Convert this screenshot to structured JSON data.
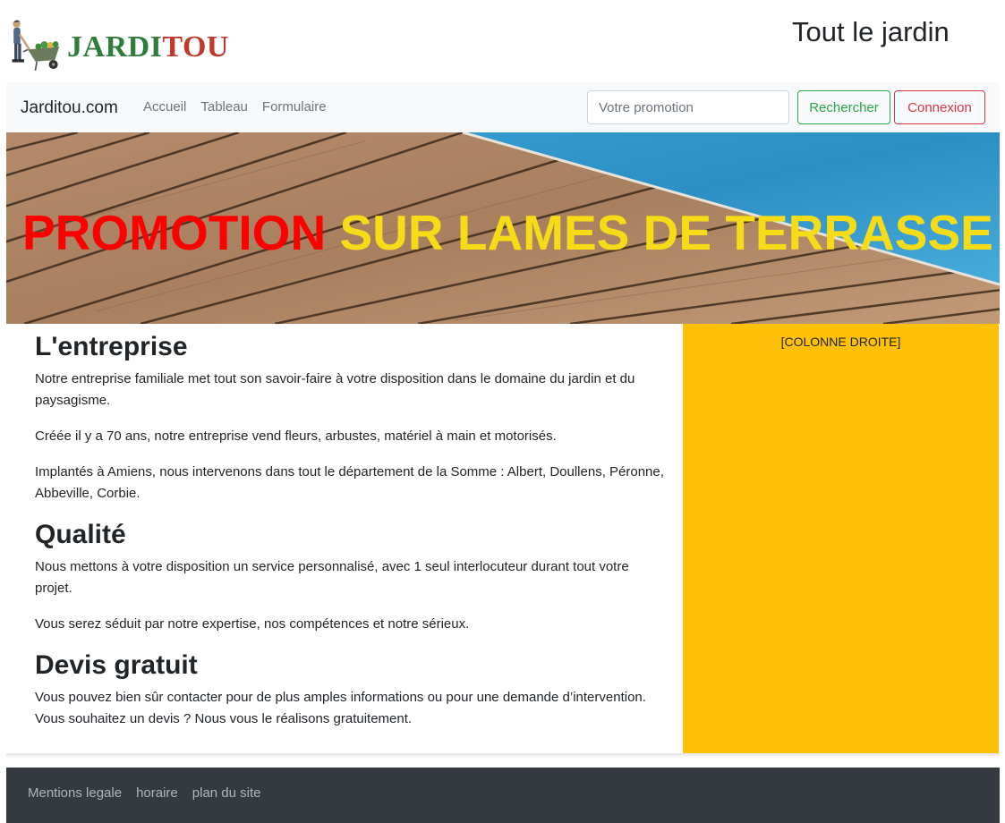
{
  "header": {
    "logo": {
      "part1": "JARDI",
      "part2": "TOU",
      "icon": "gardener-wheelbarrow-icon"
    },
    "tagline": "Tout le jardin"
  },
  "navbar": {
    "brand": "Jarditou.com",
    "links": [
      "Accueil",
      "Tableau",
      "Formulaire"
    ],
    "search_placeholder": "Votre promotion",
    "search_value": "",
    "search_button": "Rechercher",
    "login_button": "Connexion"
  },
  "hero": {
    "title_part1": "PROMOTION",
    "title_part2": "SUR LAMES DE TERRASSE"
  },
  "main": {
    "sections": [
      {
        "title": "L'entreprise",
        "paragraphs": [
          "Notre entreprise familiale met tout son savoir-faire à votre disposition dans le domaine du jardin et du paysagisme.",
          "Créée il y a 70 ans, notre entreprise vend fleurs, arbustes, matériel à main et motorisés.",
          "Implantés à Amiens, nous intervenons dans tout le département de la Somme : Albert, Doullens, Péronne, Abbeville, Corbie."
        ]
      },
      {
        "title": "Qualité",
        "paragraphs": [
          "Nous mettons à votre disposition un service personnalisé, avec 1 seul interlocuteur durant tout votre projet.",
          "Vous serez séduit par notre expertise, nos compétences et notre sérieux."
        ]
      },
      {
        "title": "Devis gratuit",
        "paragraphs": [
          "Vous pouvez bien sûr contacter pour de plus amples informations ou pour une demande d’intervention. Vous souhaitez un devis ? Nous vous le réalisons gratuitement."
        ]
      }
    ]
  },
  "aside": {
    "label": "[COLONNE DROITE]"
  },
  "footer": {
    "links": [
      "Mentions legale",
      "horaire",
      "plan du site"
    ]
  },
  "colors": {
    "logo_green": "#2e7d3a",
    "logo_red": "#c0392b",
    "success": "#28a745",
    "danger": "#dc3545",
    "aside_yellow": "#ffc107",
    "hero_red": "#ff0000",
    "hero_yellow": "#f5dc16",
    "footer_dark": "#343a40"
  }
}
